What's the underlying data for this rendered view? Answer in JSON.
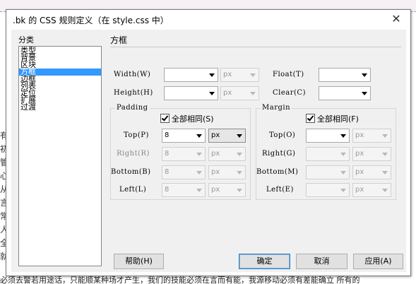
{
  "background": {
    "left_chars": [
      "有",
      "初",
      "管",
      "心",
      "从",
      "言",
      "常",
      "人",
      "全",
      "就"
    ],
    "bottom_text": "必须去警若用途话，只能顺某种场才产生，我们的技能必须在言而有能，我源移动必须有差能确立 所有的"
  },
  "dialog": {
    "title": ".bk 的 CSS 规则定义（在 style.css 中）",
    "close_glyph": "✕",
    "category_label": "分类",
    "categories": [
      "类型",
      "背景",
      "区块",
      "方框",
      "边框",
      "列表",
      "定位",
      "扩展",
      "过渡"
    ],
    "selected_category": "方框",
    "section_title": "方框",
    "fields": {
      "width": {
        "label": "Width(W)",
        "value": "",
        "unit": "px"
      },
      "height": {
        "label": "Height(H)",
        "value": "",
        "unit": "px"
      },
      "float": {
        "label": "Float(T)",
        "value": ""
      },
      "clear": {
        "label": "Clear(C)",
        "value": ""
      }
    },
    "padding": {
      "title": "Padding",
      "same_label": "全部相同(S)",
      "same_checked": true,
      "top": {
        "label": "Top(P)",
        "value": "8",
        "unit": "px"
      },
      "right": {
        "label": "Right(R)",
        "value": "8",
        "unit": "px"
      },
      "bottom": {
        "label": "Bottom(B)",
        "value": "8",
        "unit": "px"
      },
      "left": {
        "label": "Left(L)",
        "value": "8",
        "unit": "px"
      }
    },
    "margin": {
      "title": "Margin",
      "same_label": "全部相同(F)",
      "same_checked": true,
      "top": {
        "label": "Top(O)",
        "value": "",
        "unit": "px"
      },
      "right": {
        "label": "Right(G)",
        "value": "",
        "unit": "px"
      },
      "bottom": {
        "label": "Bottom(M)",
        "value": "",
        "unit": "px"
      },
      "left": {
        "label": "Left(E)",
        "value": "",
        "unit": "px"
      }
    },
    "buttons": {
      "help": "帮助(H)",
      "ok": "确定",
      "cancel": "取消",
      "apply": "应用(A)"
    },
    "colors": {
      "selection": "#3399ff",
      "dialog_bg": "#f0f0f0"
    }
  }
}
